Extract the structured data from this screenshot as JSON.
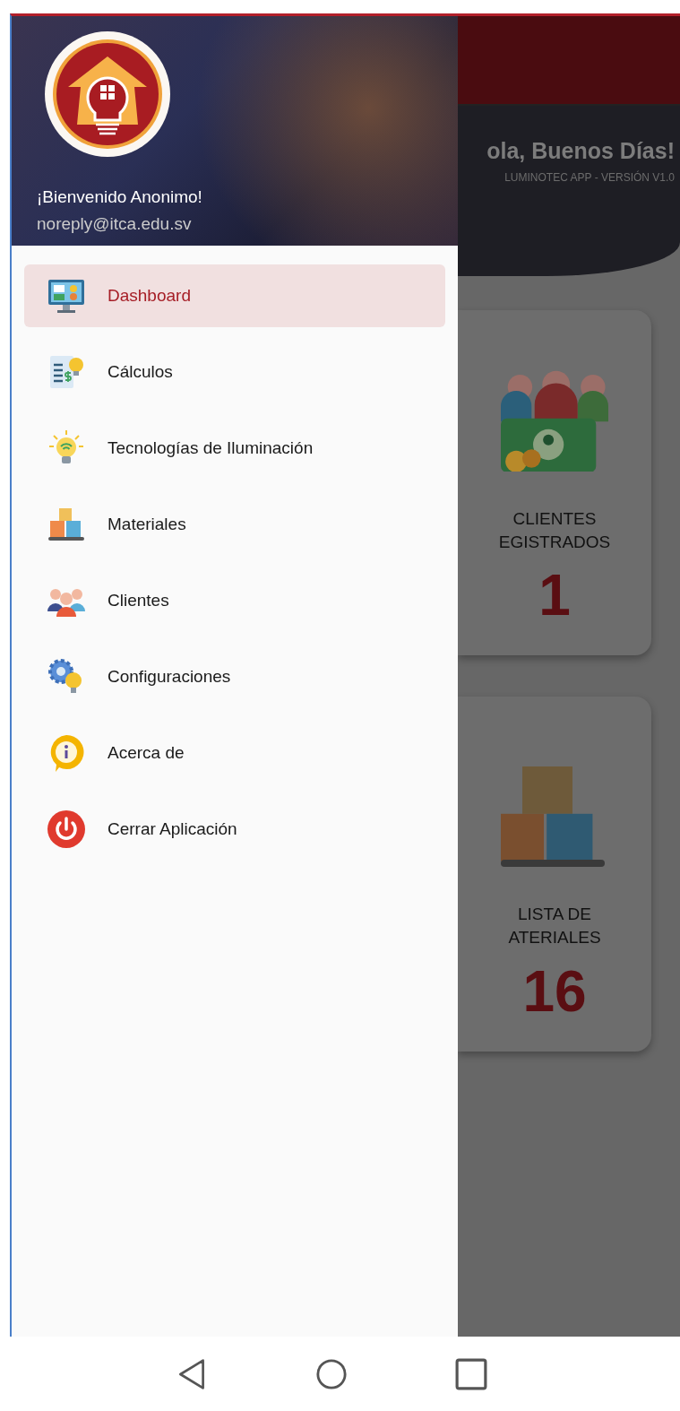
{
  "drawer": {
    "user_name": "¡Bienvenido Anonimo!",
    "user_email": "noreply@itca.edu.sv",
    "items": [
      {
        "label": "Dashboard",
        "selected": true
      },
      {
        "label": "Cálculos",
        "selected": false
      },
      {
        "label": "Tecnologías de Iluminación",
        "selected": false
      },
      {
        "label": "Materiales",
        "selected": false
      },
      {
        "label": "Clientes",
        "selected": false
      },
      {
        "label": "Configuraciones",
        "selected": false
      },
      {
        "label": "Acerca de",
        "selected": false
      },
      {
        "label": "Cerrar Aplicación",
        "selected": false
      }
    ]
  },
  "background": {
    "greeting": "ola, Buenos Días!",
    "subtitle": "LUMINOTEC APP - VERSIÓN V1.0",
    "cards": [
      {
        "kind": "clients",
        "title_lines": [
          "CLIENTES",
          "EGISTRADOS"
        ],
        "count": "1"
      },
      {
        "kind": "materials",
        "title_lines": [
          "LISTA DE",
          "ATERIALES"
        ],
        "count": "16"
      }
    ]
  }
}
